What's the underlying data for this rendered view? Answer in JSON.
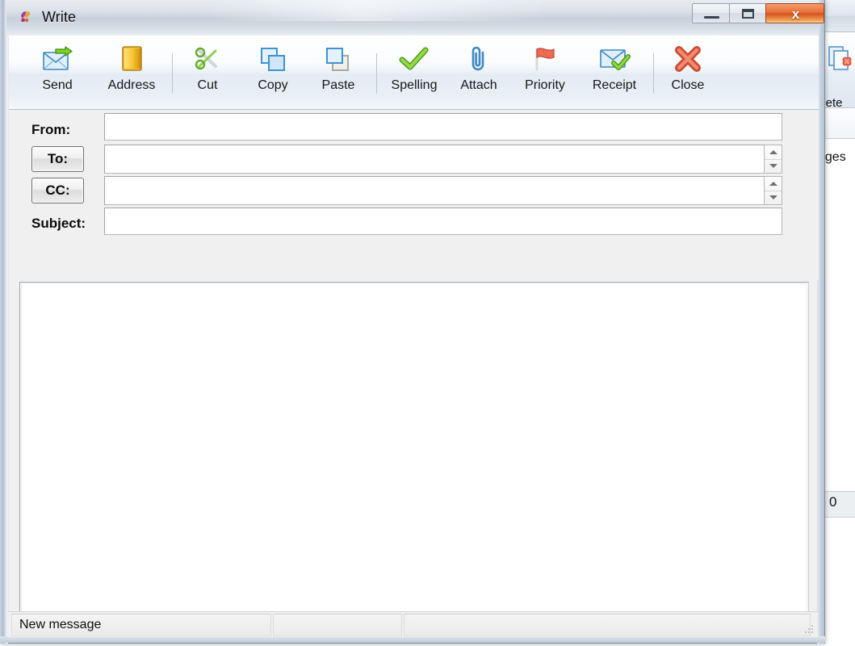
{
  "window": {
    "title": "Write",
    "app_icon": "write-app-icon",
    "controls": {
      "minimize_label": "minimize-icon",
      "maximize_label": "maximize-icon",
      "close_label": "x"
    }
  },
  "toolbar": {
    "items": [
      {
        "label": "Send",
        "icon": "send-envelope-icon"
      },
      {
        "label": "Address",
        "icon": "address-book-icon"
      },
      {
        "label": "Cut",
        "icon": "scissors-icon"
      },
      {
        "label": "Copy",
        "icon": "copy-icon"
      },
      {
        "label": "Paste",
        "icon": "paste-icon"
      },
      {
        "label": "Spelling",
        "icon": "green-check-icon"
      },
      {
        "label": "Attach",
        "icon": "paperclip-icon"
      },
      {
        "label": "Priority",
        "icon": "red-flag-icon"
      },
      {
        "label": "Receipt",
        "icon": "receipt-envelope-check-icon"
      },
      {
        "label": "Close",
        "icon": "red-x-icon"
      }
    ]
  },
  "form": {
    "from": {
      "label": "From:",
      "value": "",
      "placeholder": ""
    },
    "to": {
      "label": "To:",
      "value": "",
      "placeholder": ""
    },
    "cc": {
      "label": "CC:",
      "value": "",
      "placeholder": ""
    },
    "subject": {
      "label": "Subject:",
      "value": "",
      "placeholder": ""
    },
    "body": {
      "value": "",
      "placeholder": ""
    }
  },
  "status": {
    "message": "New message"
  },
  "background_window": {
    "delete_label": "elete",
    "list_label": "ages",
    "counter": "0"
  },
  "colors": {
    "close_button": "#d4521f",
    "frame": "#c3cedd",
    "toolbar_bg": "#eef3f9",
    "client_bg": "#f0f0f0"
  }
}
